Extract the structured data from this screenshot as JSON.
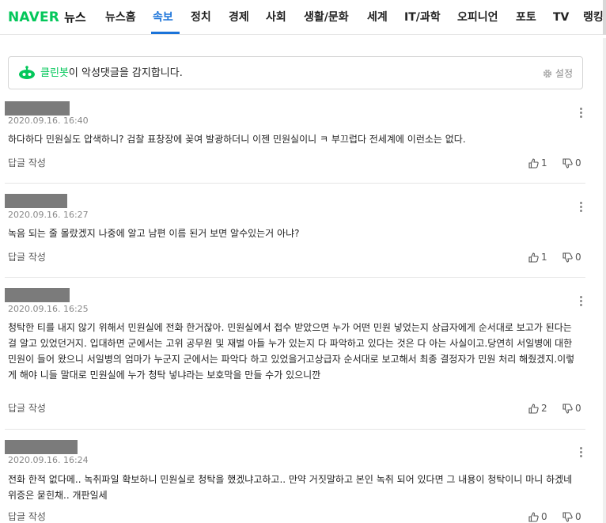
{
  "header": {
    "logo_brand": "NAVER",
    "logo_section": "뉴스",
    "nav": [
      {
        "label": "뉴스홈"
      },
      {
        "label": "속보"
      },
      {
        "label": "정치"
      },
      {
        "label": "경제"
      },
      {
        "label": "사회"
      },
      {
        "label": "생활/문화"
      },
      {
        "label": "세계"
      },
      {
        "label": "IT/과학"
      },
      {
        "label": "오피니언"
      },
      {
        "label": "포토"
      },
      {
        "label": "TV"
      },
      {
        "label": "랭킹"
      }
    ],
    "active_tab": "속보"
  },
  "cleanbot": {
    "brand": "클린봇",
    "message": "이 악성댓글을 감지합니다.",
    "settings_label": "설정"
  },
  "comments": [
    {
      "timestamp": "2020.09.16. 16:40",
      "text": "하다하다 민원실도 압색하니? 검찰 표창장에 꽂여 발광하더니 이젠 민원실이니 ㅋ 부끄럽다 전세계에 이런소는 없다.",
      "reply_label": "답글 작성",
      "likes": "1",
      "dislikes": "0"
    },
    {
      "timestamp": "2020.09.16. 16:27",
      "text": "녹음 되는 줄 몰랐겠지 나중에 알고 남편 이름 된거 보면 알수있는거 아냐?",
      "reply_label": "답글 작성",
      "likes": "1",
      "dislikes": "0"
    },
    {
      "timestamp": "2020.09.16. 16:25",
      "text": "청탁한 티를 내지 않기 위해서 민원실에 전화 한거잖아. 민원실에서 접수 받았으면 누가 어떤 민원 넣었는지 상급자에게 순서대로 보고가 된다는 걸 알고 있었던거지. 입대하면 군에서는 고위 공무원 및 재벌 아들 누가 있는지 다 파악하고 있다는 것은 다 아는 사실이고.당연히 서일병에 대한 민원이 들어 왔으니 서일병의 엄마가 누군지 군에서는 파악다 하고 있었을거고상급자 순서대로 보고해서 최종 결정자가 민원 처리 해줬겠지.이렇게 해야 니들 말대로 민원실에 누가 청탁 넣냐라는 보호막을 만들 수가 있으니깐",
      "reply_label": "답글 작성",
      "likes": "2",
      "dislikes": "0"
    },
    {
      "timestamp": "2020.09.16. 16:24",
      "text": "전화 한적 없다메.. 녹취파일 확보하니 민원실로 청탁을 했겠냐고하고.. 만약 거짓말하고 본인 녹취 되어 있다면 그 내용이 청탁이니 마니 하겠네 위증은 묻힌채.. 개판일세",
      "reply_label": "답글 작성",
      "likes": "0",
      "dislikes": "0"
    }
  ],
  "colors": {
    "brand_green": "#03c75a",
    "active_blue": "#1a73d9",
    "redacted_gray": "#7b7b7b"
  }
}
